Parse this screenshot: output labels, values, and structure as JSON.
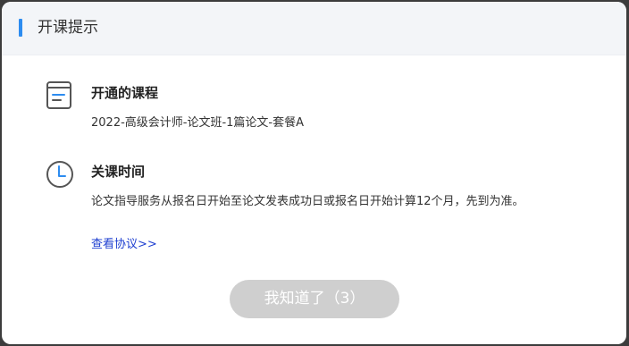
{
  "dialog": {
    "title": "开课提示",
    "accent_color": "#2d8cf0"
  },
  "courses_section": {
    "icon": "book-icon",
    "heading": "开通的课程",
    "course_name": "2022-高级会计师-论文班-1篇论文-套餐A"
  },
  "close_section": {
    "icon": "clock-icon",
    "heading": "关课时间",
    "description": "论文指导服务从报名日开始至论文发表成功日或报名日开始计算12个月，先到为准。"
  },
  "agreement_link": {
    "label": "查看协议>>",
    "color": "#1e3fd0"
  },
  "confirm_button": {
    "label": "我知道了（3）",
    "state": "disabled",
    "color": "#cfcfcf"
  }
}
